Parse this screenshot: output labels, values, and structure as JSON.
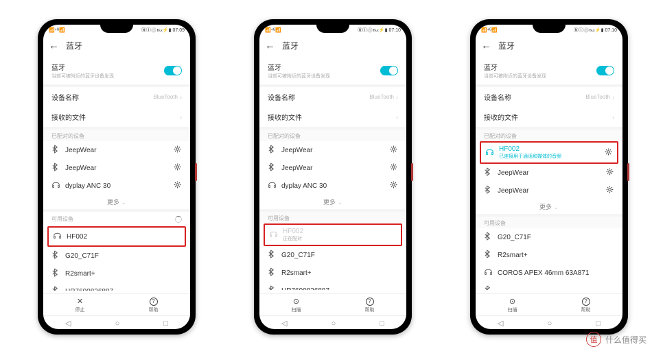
{
  "watermark": "什么值得买",
  "watermark_badge": "值",
  "phones": [
    {
      "time": "07:09",
      "status_icons": "ⓃⒾ⚪℻⚡▮",
      "title": "蓝牙",
      "bt_label": "蓝牙",
      "bt_sub": "当前可被附近的蓝牙设备发现",
      "device_name_label": "设备名称",
      "device_name_value": "BlueTooth",
      "recv_label": "接收的文件",
      "paired_label": "已配对的设备",
      "paired": [
        {
          "icon": "bt",
          "name": "JeepWear",
          "gear": true
        },
        {
          "icon": "bt",
          "name": "JeepWear",
          "gear": true
        },
        {
          "icon": "hp",
          "name": "dyplay ANC 30",
          "gear": true
        }
      ],
      "more_label": "更多",
      "avail_label": "可用设备",
      "avail_loading": true,
      "avail": [
        {
          "icon": "hp",
          "name": "HF002",
          "highlight": true
        },
        {
          "icon": "bt",
          "name": "G20_C71F"
        },
        {
          "icon": "bt",
          "name": "R2smart+"
        },
        {
          "icon": "bt",
          "name": "HR7690836887",
          "cut": true
        }
      ],
      "bottom": [
        {
          "icon": "✕",
          "label": "停止"
        },
        {
          "icon": "?",
          "label": "帮助"
        }
      ]
    },
    {
      "time": "07:10",
      "status_icons": "ⓃⒾ⚪℻⚡▮",
      "title": "蓝牙",
      "bt_label": "蓝牙",
      "bt_sub": "当前可被附近的蓝牙设备发现",
      "device_name_label": "设备名称",
      "device_name_value": "BlueTooth",
      "recv_label": "接收的文件",
      "paired_label": "已配对的设备",
      "paired": [
        {
          "icon": "bt",
          "name": "JeepWear",
          "gear": true
        },
        {
          "icon": "bt",
          "name": "JeepWear",
          "gear": true
        },
        {
          "icon": "hp",
          "name": "dyplay ANC 30",
          "gear": true
        }
      ],
      "more_label": "更多",
      "avail_label": "可用设备",
      "avail_loading": false,
      "avail": [
        {
          "icon": "hp",
          "name": "HF002",
          "sub": "正在配对",
          "highlight": true,
          "faded": true
        },
        {
          "icon": "bt",
          "name": "G20_C71F"
        },
        {
          "icon": "bt",
          "name": "R2smart+"
        },
        {
          "icon": "bt",
          "name": "HR7690836887",
          "cut": true
        }
      ],
      "bottom": [
        {
          "icon": "⊙",
          "label": "扫描"
        },
        {
          "icon": "?",
          "label": "帮助"
        }
      ]
    },
    {
      "time": "07:10",
      "status_icons": "ⓃⒾ⚪℻⚡▮",
      "title": "蓝牙",
      "bt_label": "蓝牙",
      "bt_sub": "当前可被附近的蓝牙设备发现",
      "device_name_label": "设备名称",
      "device_name_value": "BlueTooth",
      "recv_label": "接收的文件",
      "paired_label": "已配对的设备",
      "paired": [
        {
          "icon": "hp",
          "name": "HF002",
          "sub": "已连接用于通话和媒体的音频",
          "gear": true,
          "highlight": true,
          "active": true
        },
        {
          "icon": "bt",
          "name": "JeepWear",
          "gear": true
        },
        {
          "icon": "bt",
          "name": "JeepWear",
          "gear": true
        }
      ],
      "more_label": "更多",
      "avail_label": "可用设备",
      "avail_loading": false,
      "avail": [
        {
          "icon": "bt",
          "name": "G20_C71F"
        },
        {
          "icon": "bt",
          "name": "R2smart+"
        },
        {
          "icon": "hp",
          "name": "COROS APEX 46mm 63A871"
        },
        {
          "icon": "bt",
          "name": "",
          "cut": true
        }
      ],
      "bottom": [
        {
          "icon": "⊙",
          "label": "扫描"
        },
        {
          "icon": "?",
          "label": "帮助"
        }
      ]
    }
  ]
}
